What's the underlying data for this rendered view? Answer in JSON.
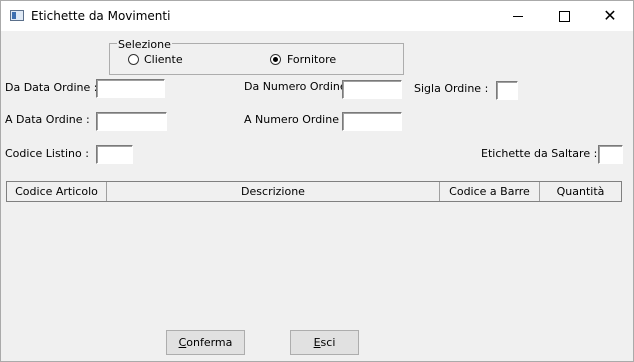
{
  "window": {
    "title": "Etichette da Movimenti"
  },
  "selezione": {
    "label": "Selezione",
    "options": [
      {
        "label": "Cliente",
        "selected": false
      },
      {
        "label": "Fornitore",
        "selected": true
      }
    ]
  },
  "form": {
    "da_data_ordine": {
      "label": "Da Data Ordine  :",
      "value": ""
    },
    "a_data_ordine": {
      "label": "A   Data Ordine :",
      "value": ""
    },
    "da_numero_ordine": {
      "label": "Da Numero Ordine :",
      "value": ""
    },
    "a_numero_ordine": {
      "label": "A  Numero Ordine :",
      "value": ""
    },
    "sigla_ordine": {
      "label": "Sigla Ordine :",
      "value": ""
    },
    "codice_listino": {
      "label": "Codice Listino :",
      "value": ""
    },
    "etichette_da_saltare": {
      "label": "Etichette da Saltare :",
      "value": ""
    }
  },
  "grid": {
    "columns": [
      "Codice Articolo",
      "Descrizione",
      "Codice a Barre",
      "Quantità"
    ],
    "rows": []
  },
  "buttons": {
    "conferma": {
      "mnemonic": "C",
      "rest": "onferma"
    },
    "esci": {
      "mnemonic": "E",
      "rest": "sci"
    }
  }
}
